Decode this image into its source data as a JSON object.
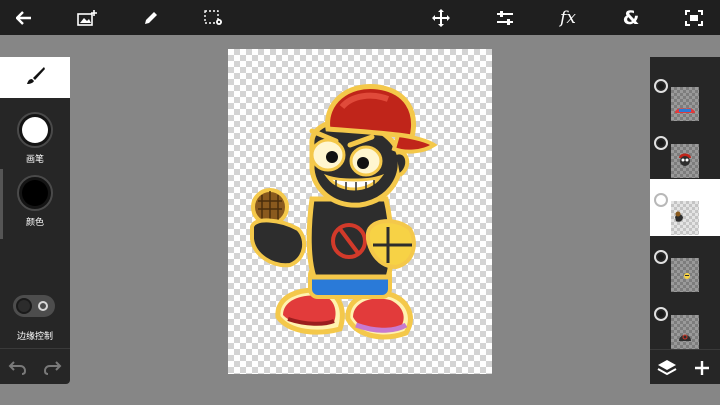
{
  "toolbar": {
    "back": "back-arrow-icon",
    "add_image": "image-add-icon",
    "brush": "pen-icon",
    "selection": "selection-settings-icon",
    "move": "move-icon",
    "adjust": "sliders-icon",
    "effects_label": "fx",
    "blend_label": "&",
    "fit": "fit-screen-icon"
  },
  "left_panel": {
    "tool": "brush-icon",
    "brush_label": "画笔",
    "brush_color": "#ffffff",
    "color_label": "颜色",
    "current_color": "#000000",
    "edge_label": "边缘控制",
    "edge_enabled": false,
    "undo": "undo-icon",
    "redo": "redo-icon"
  },
  "layers": {
    "items": [
      {
        "name": "layer-1",
        "active": false
      },
      {
        "name": "layer-2",
        "active": false
      },
      {
        "name": "layer-3",
        "active": true
      },
      {
        "name": "layer-4",
        "active": false
      },
      {
        "name": "layer-5",
        "active": false
      }
    ],
    "layers_button": "layers-icon",
    "add_button": "plus-icon"
  },
  "colors": {
    "toolbar_bg": "#1f1f1f",
    "panel_bg": "#262626",
    "workspace_bg": "#868686",
    "active": "#ffffff"
  }
}
